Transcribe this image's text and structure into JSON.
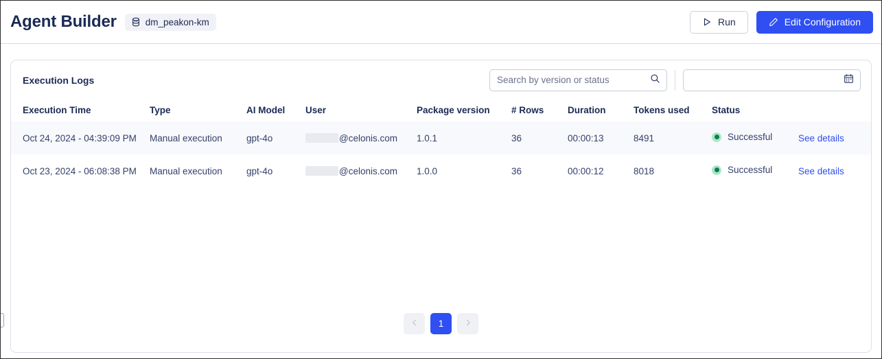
{
  "header": {
    "title": "Agent Builder",
    "badge": {
      "icon": "data-model-icon",
      "label": "dm_peakon-km"
    },
    "run_button": {
      "icon": "play-icon",
      "label": "Run"
    },
    "edit_button": {
      "icon": "pencil-icon",
      "label": "Edit Configuration"
    }
  },
  "card": {
    "title": "Execution Logs",
    "search": {
      "icon": "search-icon",
      "placeholder": "Search by version or status",
      "value": ""
    },
    "date_filter": {
      "icon": "calendar-icon",
      "placeholder": "",
      "value": ""
    },
    "columns": [
      "Execution Time",
      "Type",
      "AI Model",
      "User",
      "Package version",
      "# Rows",
      "Duration",
      "Tokens used",
      "Status",
      ""
    ],
    "rows": [
      {
        "execution_time": "Oct 24, 2024 - 04:39:09 PM",
        "type": "Manual execution",
        "ai_model": "gpt-4o",
        "user_redacted": true,
        "user_domain": "@celonis.com",
        "package_version": "1.0.1",
        "rows": "36",
        "duration": "00:00:13",
        "tokens_used": "8491",
        "status": "Successful",
        "status_color": "#147b52",
        "action": "See details"
      },
      {
        "execution_time": "Oct 23, 2024 - 06:08:38 PM",
        "type": "Manual execution",
        "ai_model": "gpt-4o",
        "user_redacted": true,
        "user_domain": "@celonis.com",
        "package_version": "1.0.0",
        "rows": "36",
        "duration": "00:00:12",
        "tokens_used": "8018",
        "status": "Successful",
        "status_color": "#147b52",
        "action": "See details"
      }
    ],
    "pagination": {
      "prev_icon": "chevron-left-icon",
      "next_icon": "chevron-right-icon",
      "current_page": "1"
    }
  },
  "colors": {
    "accent": "#2f4ff2",
    "text": "#1b2a54",
    "success": "#147b52",
    "success_ring": "#a9e8c9"
  }
}
